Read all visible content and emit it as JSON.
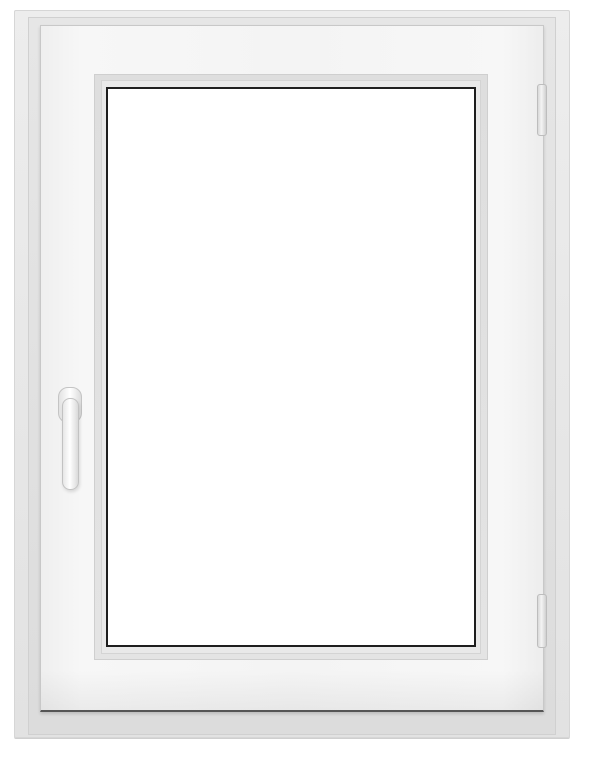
{
  "image": {
    "subject": "",
    "colors": {
      "frame": "#e6e6e6",
      "sash": "#f4f4f4",
      "glass": "#ffffff",
      "glass_edge": "#1e1e1e",
      "handle": "#f2f2f2"
    },
    "icons": {
      "handle": "window-handle-icon",
      "hinge": "hinge-icon"
    }
  }
}
